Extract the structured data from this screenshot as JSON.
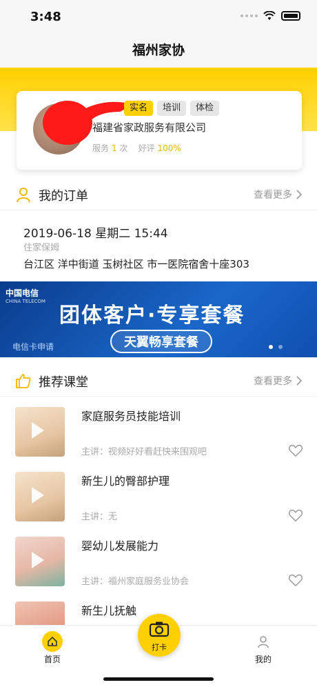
{
  "status_bar": {
    "time": "3:48"
  },
  "nav": {
    "title": "福州家协"
  },
  "profile": {
    "tags": [
      "实名",
      "培训",
      "体检"
    ],
    "company": "福建省家政服务有限公司",
    "service_label": "服务",
    "service_count": "1",
    "service_unit": "次",
    "rating_label": "好评",
    "rating_value": "100%"
  },
  "orders": {
    "title": "我的订单",
    "more": "查看更多",
    "latest": {
      "datetime": "2019-06-18 星期二 15:44",
      "type": "住家保姆",
      "address": "台江区 洋中街道 玉树社区 市一医院宿舍十座303"
    }
  },
  "banner": {
    "brand": "中国电信",
    "brand_en": "CHINA TELECOM",
    "headline": "团体客户·专享套餐",
    "pill": "天翼畅享套餐",
    "note": "电信卡申请"
  },
  "courses": {
    "title": "推荐课堂",
    "more": "查看更多",
    "items": [
      {
        "name": "家庭服务员技能培训",
        "speaker": "主讲：视频好好看赶快来围观吧"
      },
      {
        "name": "新生儿的臀部护理",
        "speaker": "主讲：无"
      },
      {
        "name": "婴幼儿发展能力",
        "speaker": "主讲：福州家庭服务业协会"
      },
      {
        "name": "新生儿抚触",
        "speaker": ""
      }
    ]
  },
  "tabbar": {
    "home": "首页",
    "checkin": "打卡",
    "me": "我的"
  },
  "colors": {
    "accent": "#ffd000",
    "banner": "#1a67c9"
  }
}
